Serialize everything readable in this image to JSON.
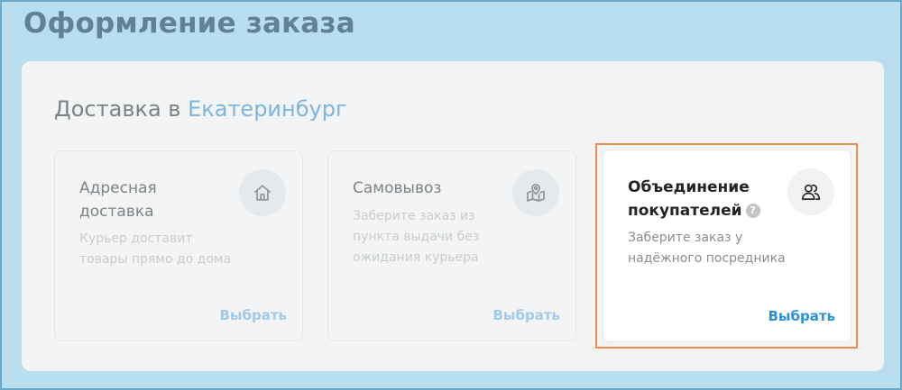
{
  "page": {
    "title": "Оформление заказа"
  },
  "delivery": {
    "prefix": "Доставка в",
    "city": "Екатеринбург"
  },
  "options": [
    {
      "title": "Адресная доставка",
      "description": "Курьер доставит товары прямо до дома",
      "button_label": "Выбрать",
      "icon": "home-icon",
      "selected": false
    },
    {
      "title": "Самовывоз",
      "description": "Заберите заказ из пункта выдачи без ожидания курьера",
      "button_label": "Выбрать",
      "icon": "map-pin-icon",
      "selected": false
    },
    {
      "title": "Объединение покупателей",
      "description": "Заберите заказ у надёжного посредника",
      "button_label": "Выбрать",
      "icon": "users-icon",
      "help_icon": "?",
      "selected": true
    }
  ],
  "colors": {
    "background": "#b9def0",
    "accent": "#2d8fd8",
    "selection_outline": "#f08d4e",
    "city_link": "#7eb5df"
  }
}
